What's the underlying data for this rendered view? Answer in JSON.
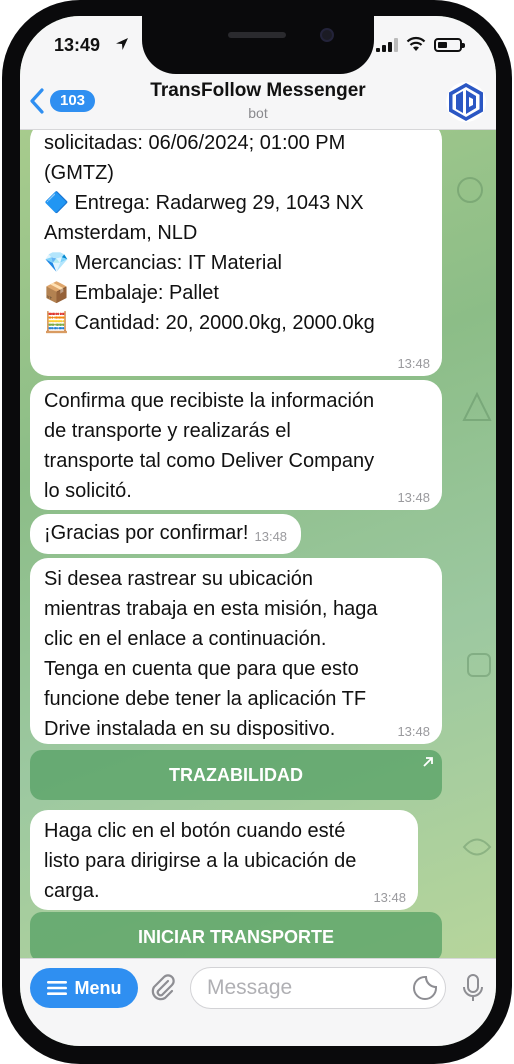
{
  "status_bar": {
    "time": "13:49"
  },
  "header": {
    "back_count": "103",
    "title": "TransFollow Messenger",
    "subtitle": "bot"
  },
  "messages": [
    {
      "lines": [
        "solicitadas: 06/06/2024; 01:00 PM",
        "(GMTZ)",
        "🔷 Entrega: Radarweg 29, 1043 NX",
        "Amsterdam, NLD",
        "💎 Mercancias: IT Material",
        "📦 Embalaje: Pallet",
        "🧮 Cantidad: 20, 2000.0kg, 2000.0kg"
      ],
      "time": "13:48"
    },
    {
      "lines": [
        "Confirma que recibiste la información",
        "de transporte y realizarás el",
        "transporte tal como Deliver Company",
        "lo solicitó."
      ],
      "time": "13:48"
    },
    {
      "lines": [
        "¡Gracias por confirmar!"
      ],
      "time": "13:48"
    },
    {
      "lines": [
        "Si desea rastrear su ubicación",
        "mientras trabaja en esta misión, haga",
        "clic en el enlace a continuación.",
        "Tenga en cuenta que para que esto",
        "funcione debe tener la aplicación TF",
        "Drive instalada en su dispositivo."
      ],
      "time": "13:48"
    },
    {
      "lines": [
        "Haga clic en el botón cuando esté",
        "listo para dirigirse a la ubicación de",
        "carga."
      ],
      "time": "13:48"
    }
  ],
  "buttons": {
    "trazabilidad": "TRAZABILIDAD",
    "iniciar": "INICIAR TRANSPORTE"
  },
  "input_bar": {
    "menu_label": "Menu",
    "placeholder": "Message"
  },
  "colors": {
    "accent": "#2f8ff1",
    "chat_bg": "#8fbf86",
    "bubble": "#ffffff",
    "inline_button": "#56a064",
    "logo": "#2b57c4"
  }
}
